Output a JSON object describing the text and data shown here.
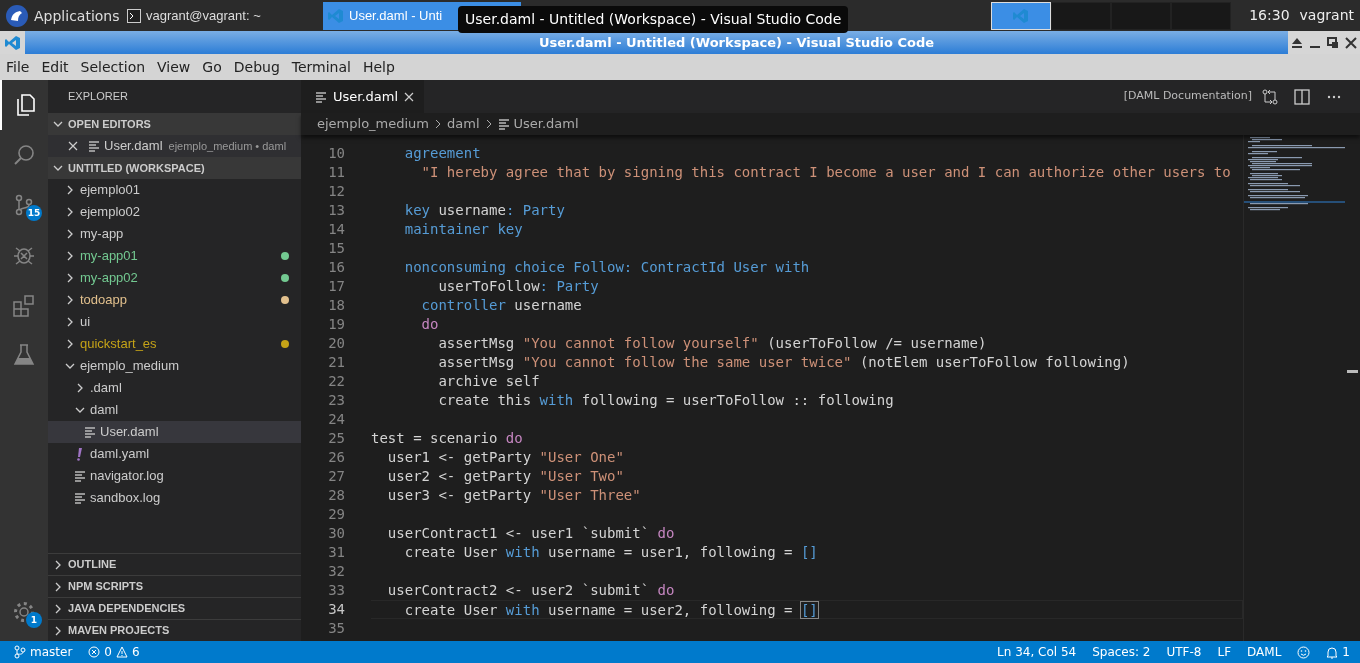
{
  "taskbar": {
    "menu": "Applications",
    "tasks": [
      {
        "label": "vagrant@vagrant: ~",
        "kind": "terminal",
        "selected": false
      },
      {
        "label": "User.daml - Unti",
        "kind": "editor",
        "selected": true
      }
    ],
    "tooltip": "User.daml - Untitled (Workspace) - Visual Studio Code",
    "workspaces": [
      {
        "selected": true
      },
      {
        "selected": false
      },
      {
        "selected": false
      },
      {
        "selected": false
      }
    ],
    "clock": "16:30",
    "user": "vagrant"
  },
  "window": {
    "title": "User.daml - Untitled (Workspace) - Visual Studio Code"
  },
  "menu": [
    "File",
    "Edit",
    "Selection",
    "View",
    "Go",
    "Debug",
    "Terminal",
    "Help"
  ],
  "activity_bar": [
    {
      "kind": "explorer",
      "selected": true
    },
    {
      "kind": "search",
      "selected": false
    },
    {
      "kind": "source_control",
      "selected": false,
      "badge": "15"
    },
    {
      "kind": "debug",
      "selected": false
    },
    {
      "kind": "extensions",
      "selected": false
    },
    {
      "kind": "test",
      "selected": false
    }
  ],
  "manage": {
    "badge": "1"
  },
  "sidebar": {
    "title": "EXPLORER",
    "open_editors": {
      "title": "OPEN EDITORS",
      "expanded": true,
      "items": [
        {
          "label": "User.daml",
          "description": "ejemplo_medium • daml"
        }
      ]
    },
    "workspace": {
      "title": "UNTITLED (WORKSPACE)",
      "expanded": true,
      "items": [
        {
          "label": "ejemplo01",
          "kind": "folder",
          "expanded": false,
          "selected": false
        },
        {
          "label": "ejemplo02",
          "kind": "folder",
          "expanded": false,
          "selected": false
        },
        {
          "label": "my-app",
          "kind": "folder",
          "expanded": false,
          "selected": false
        },
        {
          "label": "my-app01",
          "kind": "folder",
          "expanded": false,
          "selected": false,
          "color": "#73c991"
        },
        {
          "label": "my-app02",
          "kind": "folder",
          "expanded": false,
          "selected": false,
          "color": "#73c991"
        },
        {
          "label": "todoapp",
          "kind": "folder",
          "expanded": false,
          "selected": false,
          "color": "#e2c08d"
        },
        {
          "label": "ui",
          "kind": "folder",
          "expanded": false,
          "selected": false
        },
        {
          "label": "quickstart_es",
          "kind": "folder",
          "expanded": false,
          "selected": false,
          "color": "#c5a317"
        },
        {
          "label": "ejemplo_medium",
          "kind": "folder",
          "expanded": true,
          "selected": false,
          "children": [
            {
              "label": ".daml",
              "kind": "folder",
              "expanded": false,
              "selected": false
            },
            {
              "label": "daml",
              "kind": "folder",
              "expanded": true,
              "selected": false,
              "children": [
                {
                  "label": "User.daml",
                  "kind": "file",
                  "selected": true
                }
              ]
            },
            {
              "label": "daml.yaml",
              "kind": "yaml",
              "selected": false
            },
            {
              "label": "navigator.log",
              "kind": "file",
              "selected": false
            },
            {
              "label": "sandbox.log",
              "kind": "file",
              "selected": false
            }
          ]
        }
      ]
    },
    "sections": [
      {
        "title": "OUTLINE",
        "expanded": false
      },
      {
        "title": "NPM SCRIPTS",
        "expanded": false
      },
      {
        "title": "JAVA DEPENDENCIES",
        "expanded": false
      },
      {
        "title": "MAVEN PROJECTS",
        "expanded": false
      }
    ]
  },
  "editor": {
    "tabs": [
      {
        "label": "User.daml",
        "selected": true
      }
    ],
    "actions_label": "[DAML Documentation]",
    "breadcrumb": [
      {
        "label": "ejemplo_medium",
        "kind": "folder"
      },
      {
        "label": "daml",
        "kind": "folder"
      },
      {
        "label": "User.daml",
        "kind": "file"
      }
    ],
    "lines": [
      {
        "number": "10",
        "current": false,
        "tokens": [
          {
            "kind": "keyword",
            "text": "    agreement"
          }
        ]
      },
      {
        "number": "11",
        "current": false,
        "tokens": [
          {
            "kind": "string",
            "text": "      \"I hereby agree that by signing this contract I become a user and I can authorize other users to"
          }
        ]
      },
      {
        "number": "12",
        "current": false
      },
      {
        "number": "13",
        "current": false,
        "tokens": [
          {
            "kind": "keyword",
            "text": "    key"
          },
          {
            "kind": "text",
            "text": " username"
          },
          {
            "kind": "keyword",
            "text": ": Party"
          }
        ]
      },
      {
        "number": "14",
        "current": false,
        "tokens": [
          {
            "kind": "keyword",
            "text": "    maintainer key"
          }
        ]
      },
      {
        "number": "15",
        "current": false
      },
      {
        "number": "16",
        "current": false,
        "tokens": [
          {
            "kind": "keyword",
            "text": "    nonconsuming choice Follow: ContractId User with"
          }
        ]
      },
      {
        "number": "17",
        "current": false,
        "tokens": [
          {
            "kind": "text",
            "text": "        userToFollow"
          },
          {
            "kind": "keyword",
            "text": ": Party"
          }
        ]
      },
      {
        "number": "18",
        "current": false,
        "tokens": [
          {
            "kind": "keyword",
            "text": "      controller"
          },
          {
            "kind": "text",
            "text": " username"
          }
        ]
      },
      {
        "number": "19",
        "current": false,
        "tokens": [
          {
            "kind": "control",
            "text": "      do"
          }
        ]
      },
      {
        "number": "20",
        "current": false,
        "tokens": [
          {
            "kind": "text",
            "text": "        assertMsg "
          },
          {
            "kind": "string",
            "text": "\"You cannot follow yourself\""
          },
          {
            "kind": "text",
            "text": " (userToFollow /= username)"
          }
        ]
      },
      {
        "number": "21",
        "current": false,
        "tokens": [
          {
            "kind": "text",
            "text": "        assertMsg "
          },
          {
            "kind": "string",
            "text": "\"You cannot follow the same user twice\""
          },
          {
            "kind": "text",
            "text": " (notElem userToFollow following)"
          }
        ]
      },
      {
        "number": "22",
        "current": false,
        "tokens": [
          {
            "kind": "text",
            "text": "        archive self"
          }
        ]
      },
      {
        "number": "23",
        "current": false,
        "tokens": [
          {
            "kind": "text",
            "text": "        create this "
          },
          {
            "kind": "keyword",
            "text": "with"
          },
          {
            "kind": "text",
            "text": " following = userToFollow :: following"
          }
        ]
      },
      {
        "number": "24",
        "current": false
      },
      {
        "number": "25",
        "current": false,
        "tokens": [
          {
            "kind": "text",
            "text": "test = scenario "
          },
          {
            "kind": "control",
            "text": "do"
          }
        ]
      },
      {
        "number": "26",
        "current": false,
        "tokens": [
          {
            "kind": "text",
            "text": "  user1 <- getParty "
          },
          {
            "kind": "string",
            "text": "\"User One\""
          }
        ]
      },
      {
        "number": "27",
        "current": false,
        "tokens": [
          {
            "kind": "text",
            "text": "  user2 <- getParty "
          },
          {
            "kind": "string",
            "text": "\"User Two\""
          }
        ]
      },
      {
        "number": "28",
        "current": false,
        "tokens": [
          {
            "kind": "text",
            "text": "  user3 <- getParty "
          },
          {
            "kind": "string",
            "text": "\"User Three\""
          }
        ]
      },
      {
        "number": "29",
        "current": false
      },
      {
        "number": "30",
        "current": false,
        "tokens": [
          {
            "kind": "text",
            "text": "  userContract1 <- user1 `submit` "
          },
          {
            "kind": "control",
            "text": "do"
          }
        ]
      },
      {
        "number": "31",
        "current": false,
        "tokens": [
          {
            "kind": "text",
            "text": "    create User "
          },
          {
            "kind": "keyword",
            "text": "with"
          },
          {
            "kind": "text",
            "text": " username = user1, following = "
          },
          {
            "kind": "keyword",
            "text": "[]"
          }
        ]
      },
      {
        "number": "32",
        "current": false
      },
      {
        "number": "33",
        "current": false,
        "tokens": [
          {
            "kind": "text",
            "text": "  userContract2 <- user2 `submit` "
          },
          {
            "kind": "control",
            "text": "do"
          }
        ]
      },
      {
        "number": "34",
        "current": true,
        "tokens": [
          {
            "kind": "text",
            "text": "    create User "
          },
          {
            "kind": "keyword",
            "text": "with"
          },
          {
            "kind": "text",
            "text": " username = user2, following = "
          },
          {
            "kind": "match",
            "text": "[]"
          }
        ]
      },
      {
        "number": "35",
        "current": false
      }
    ]
  },
  "status_bar": {
    "branch": "master",
    "errors": "0",
    "warnings": "6",
    "items": [
      "Ln 34, Col 54",
      "Spaces: 2",
      "UTF-8",
      "LF",
      "DAML"
    ],
    "notifications": "1"
  }
}
